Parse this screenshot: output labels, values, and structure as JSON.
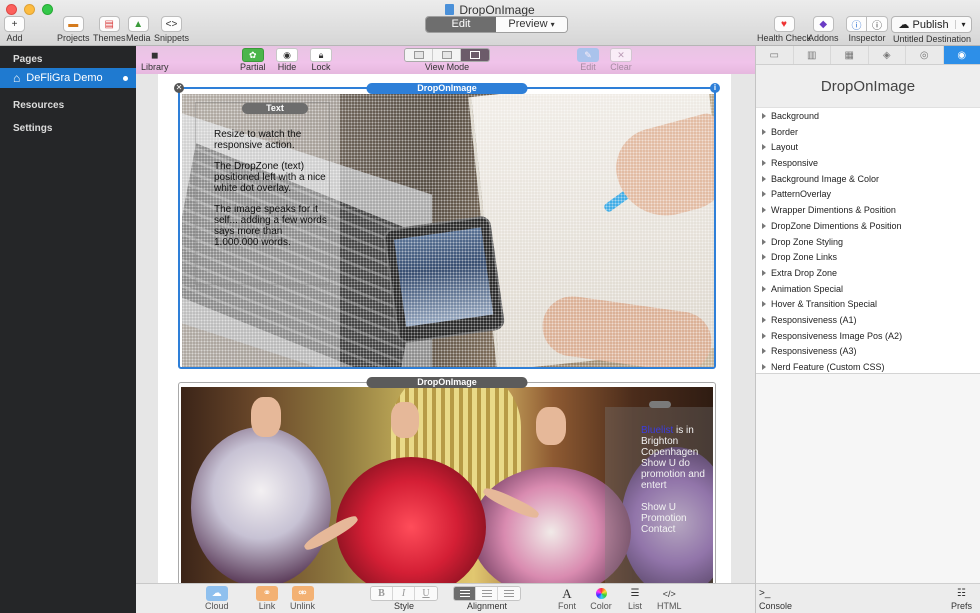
{
  "window": {
    "title": "DropOnImage"
  },
  "toolbar": {
    "add": "Add",
    "projects": "Projects",
    "themes": "Themes",
    "media": "Media",
    "snippets": "Snippets",
    "edit": "Edit",
    "preview": "Preview",
    "health_check": "Health Check",
    "addons": "Addons",
    "inspector": "Inspector",
    "publish": "Publish",
    "destination": "Untitled Destination"
  },
  "sidebar": {
    "pages_header": "Pages",
    "current_page": "DeFliGra Demo",
    "items": [
      "Resources",
      "Settings"
    ]
  },
  "edit_toolbar": {
    "library": "Library",
    "partial": "Partial",
    "hide": "Hide",
    "lock": "Lock",
    "view_mode": "View Mode",
    "edit": "Edit",
    "clear": "Clear"
  },
  "canvas": {
    "zone1_label": "DropOnImage",
    "text_label": "Text",
    "overlay_paragraphs": [
      "Resize to watch the responsive action.",
      "The DropZone (text) positioned left with a nice white dot overlay.",
      "The image speaks for it self... adding a few words says more than 1.000.000 words."
    ],
    "zone2_label": "DropOnImage",
    "side_text": {
      "p1_highlight": "Bluelist",
      "p1_rest": " is in Brighton Copenhagen Show U do promotion and entert",
      "p2": "Show U Promotion Contact"
    }
  },
  "bottom_toolbar": {
    "cloud": "Cloud",
    "link": "Link",
    "unlink": "Unlink",
    "style": "Style",
    "alignment": "Alignment",
    "font": "Font",
    "color": "Color",
    "list": "List",
    "html": "HTML"
  },
  "inspector": {
    "title": "DropOnImage",
    "sections": [
      "Background",
      "Border",
      "Layout",
      "Responsive",
      "Background Image & Color",
      "PatternOverlay",
      "Wrapper Dimentions & Position",
      "DropZone Dimentions & Position",
      "Drop Zone Styling",
      "Drop Zone Links",
      "Extra Drop Zone",
      "Animation Special",
      "Hover & Transition Special",
      "Responsiveness (A1)",
      "Responsiveness Image Pos (A2)",
      "Responsiveness (A3)",
      "Nerd Feature (Custom CSS)"
    ],
    "console": "Console",
    "prefs": "Prefs"
  }
}
